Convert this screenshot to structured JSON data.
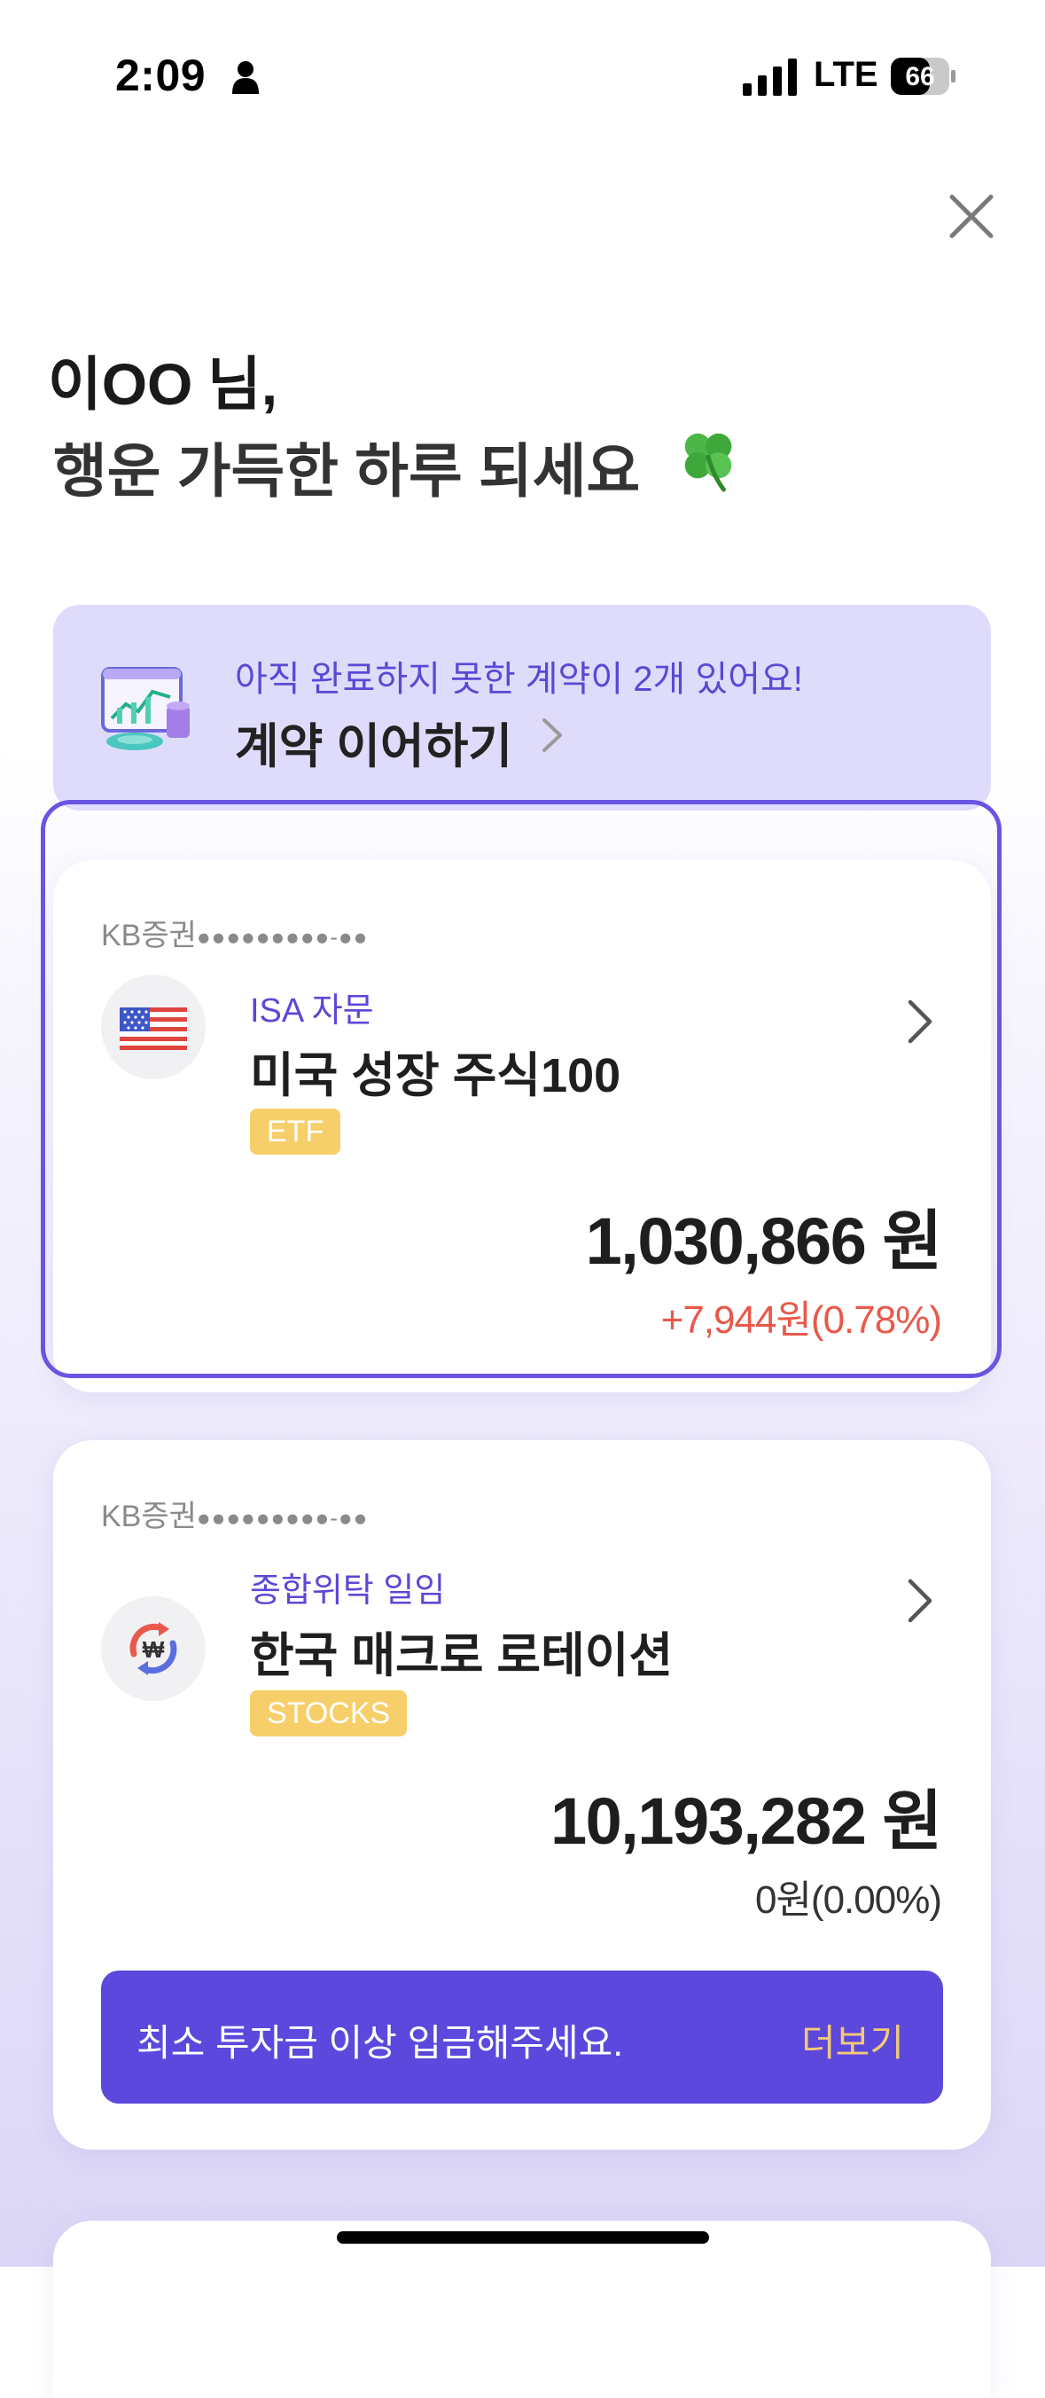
{
  "status_bar": {
    "time": "2:09",
    "network": "LTE",
    "battery": "66"
  },
  "greeting": {
    "name": "이OO",
    "honorific": "님,",
    "line2": "행운 가득한 하루 되세요"
  },
  "banner": {
    "subtitle": "아직 완료하지 못한 계약이 2개 있어요!",
    "action": "계약 이어하기"
  },
  "accounts": [
    {
      "broker": "KB증권",
      "masked": "●●●●●●●●●-●●",
      "type": "ISA 자문",
      "name": "미국 성장 주식100",
      "tag": "ETF",
      "icon": "us-flag-icon",
      "amount": "1,030,866 원",
      "change": "+7,944원(0.78%)",
      "change_color": "#e8594a"
    },
    {
      "broker": "KB증권",
      "masked": "●●●●●●●●●-●●",
      "type": "종합위탁 일임",
      "name": "한국 매크로 로테이션",
      "tag": "STOCKS",
      "icon": "won-rotation-icon",
      "amount": "10,193,282 원",
      "change": "0원(0.00%)",
      "change_color": "#333333",
      "notice": {
        "text": "최소 투자금 이상 입금해주세요.",
        "more": "더보기"
      }
    }
  ],
  "colors": {
    "accent": "#5c48dc",
    "tag": "#f7cf6a",
    "banner_bg": "#dfdcfb",
    "more_link": "#f3c978"
  }
}
